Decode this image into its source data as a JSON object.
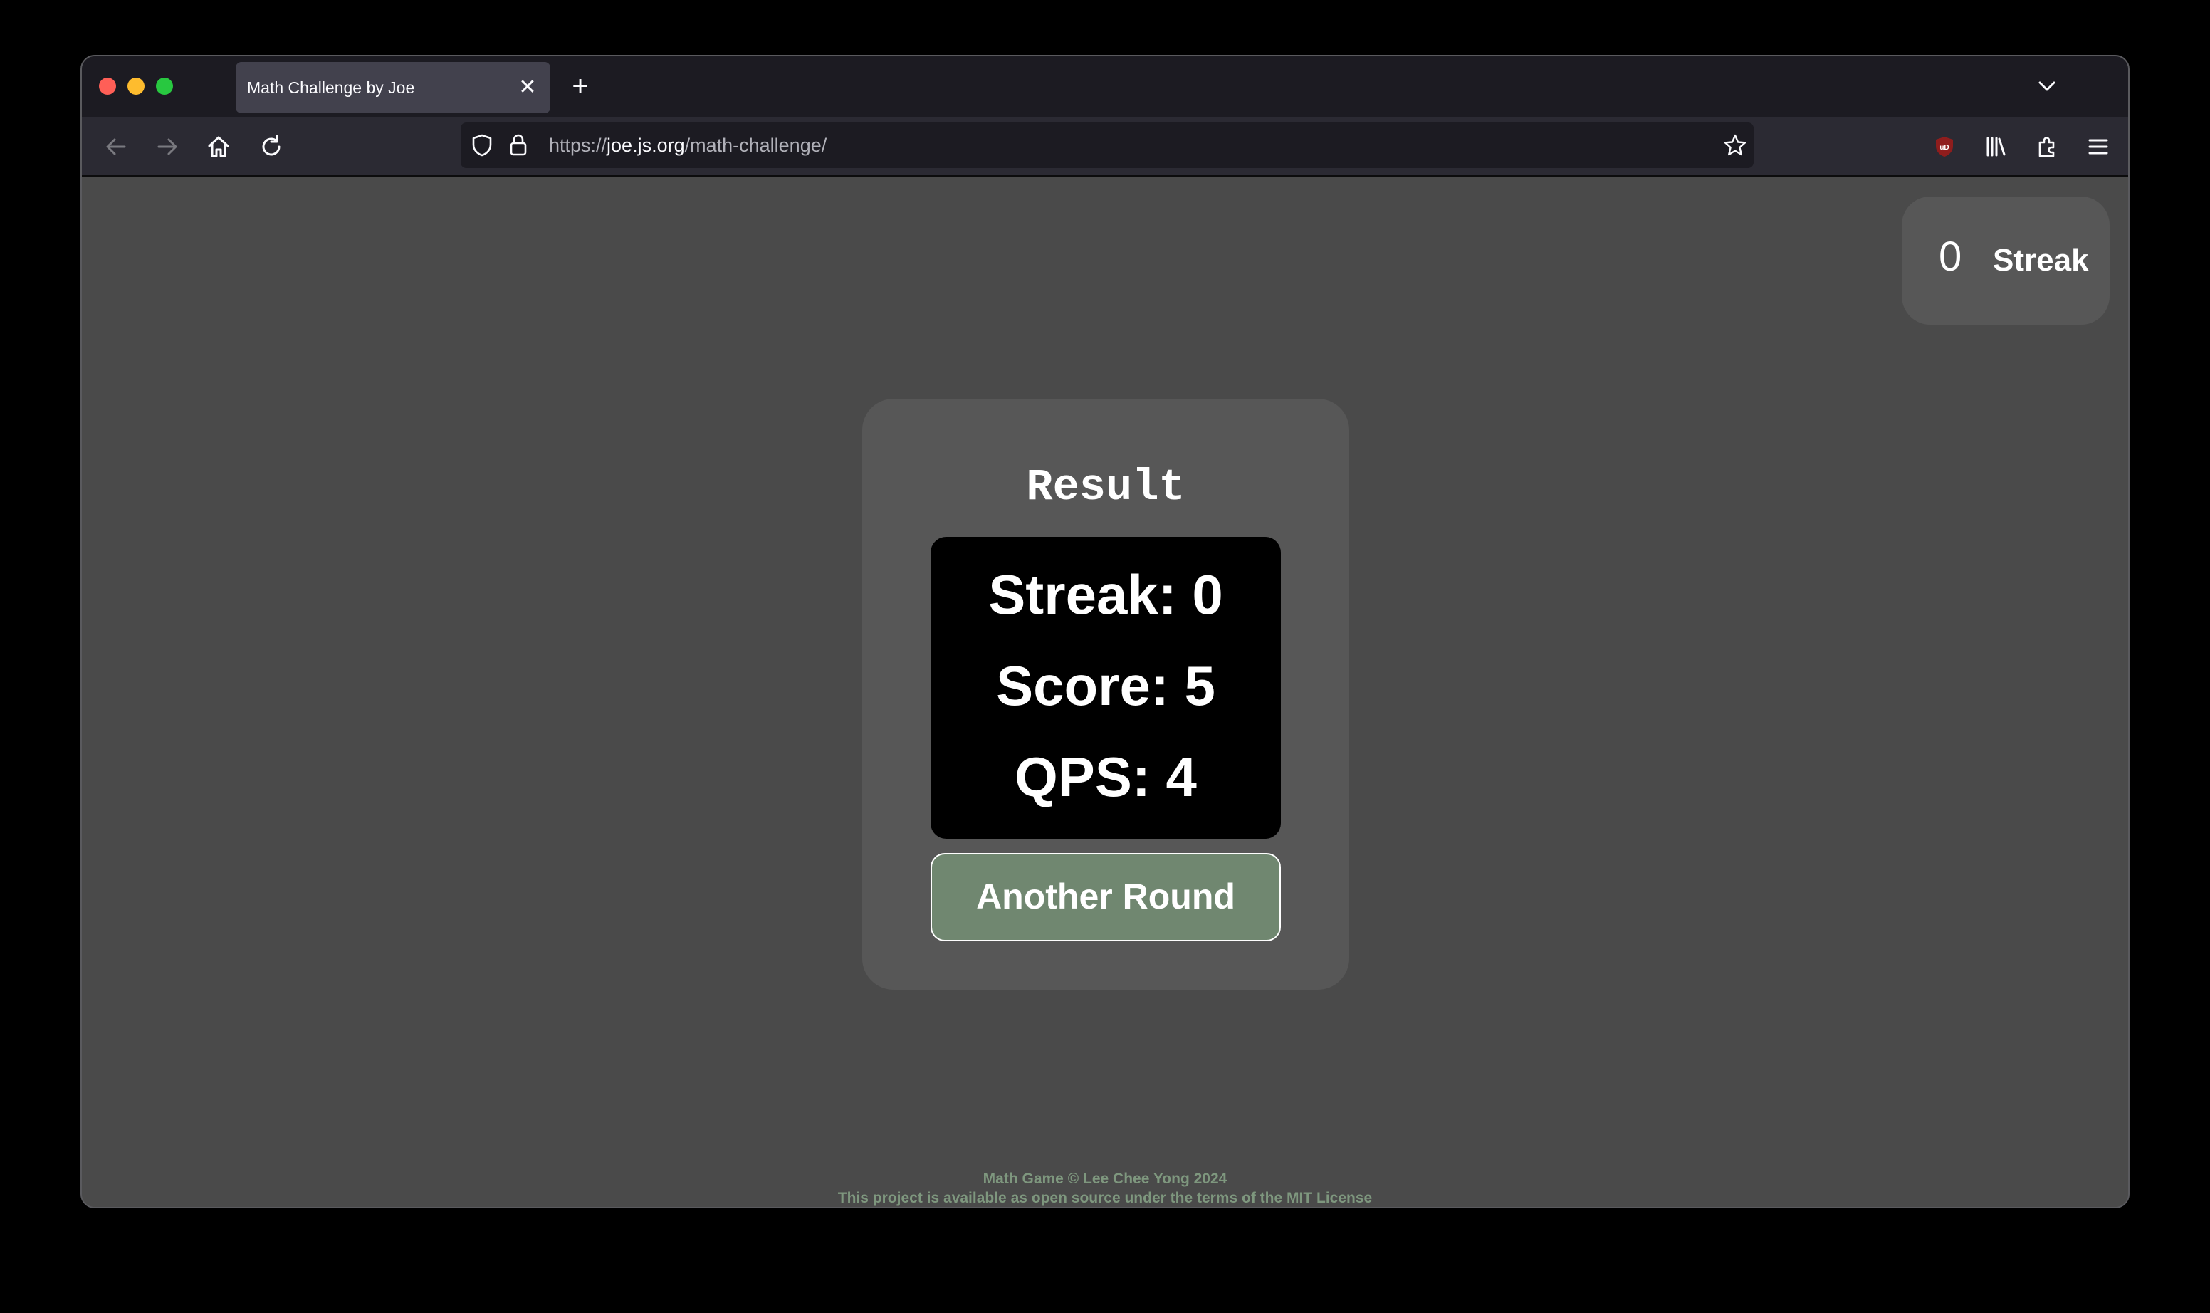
{
  "browser": {
    "tab": {
      "title": "Math Challenge by Joe",
      "close": "✕"
    },
    "new_tab": "+",
    "url": {
      "scheme": "https://",
      "host": "joe.js.org",
      "path": "/math-challenge/"
    }
  },
  "streak_badge": {
    "count": "0",
    "label": "Streak"
  },
  "result": {
    "title": "Result",
    "streak": "Streak: 0",
    "score": "Score: 5",
    "qps": "QPS: 4",
    "button_label": "Another Round"
  },
  "footer": {
    "line1": "Math Game © Lee Chee Yong 2024",
    "line2_link1": "This project",
    "line2_text": " is available as open source under the terms of the ",
    "line2_link2": "MIT License"
  },
  "colors": {
    "page_bg": "#4a4a4a",
    "card_bg": "#575757",
    "button_bg": "#708770",
    "footer_text": "#7e977e"
  },
  "icons": [
    "back-arrow-icon",
    "forward-arrow-icon",
    "home-icon",
    "reload-icon",
    "shield-icon",
    "lock-icon",
    "bookmark-star-icon",
    "ublock-icon",
    "library-icon",
    "extensions-icon",
    "menu-icon",
    "chevron-down-icon"
  ]
}
